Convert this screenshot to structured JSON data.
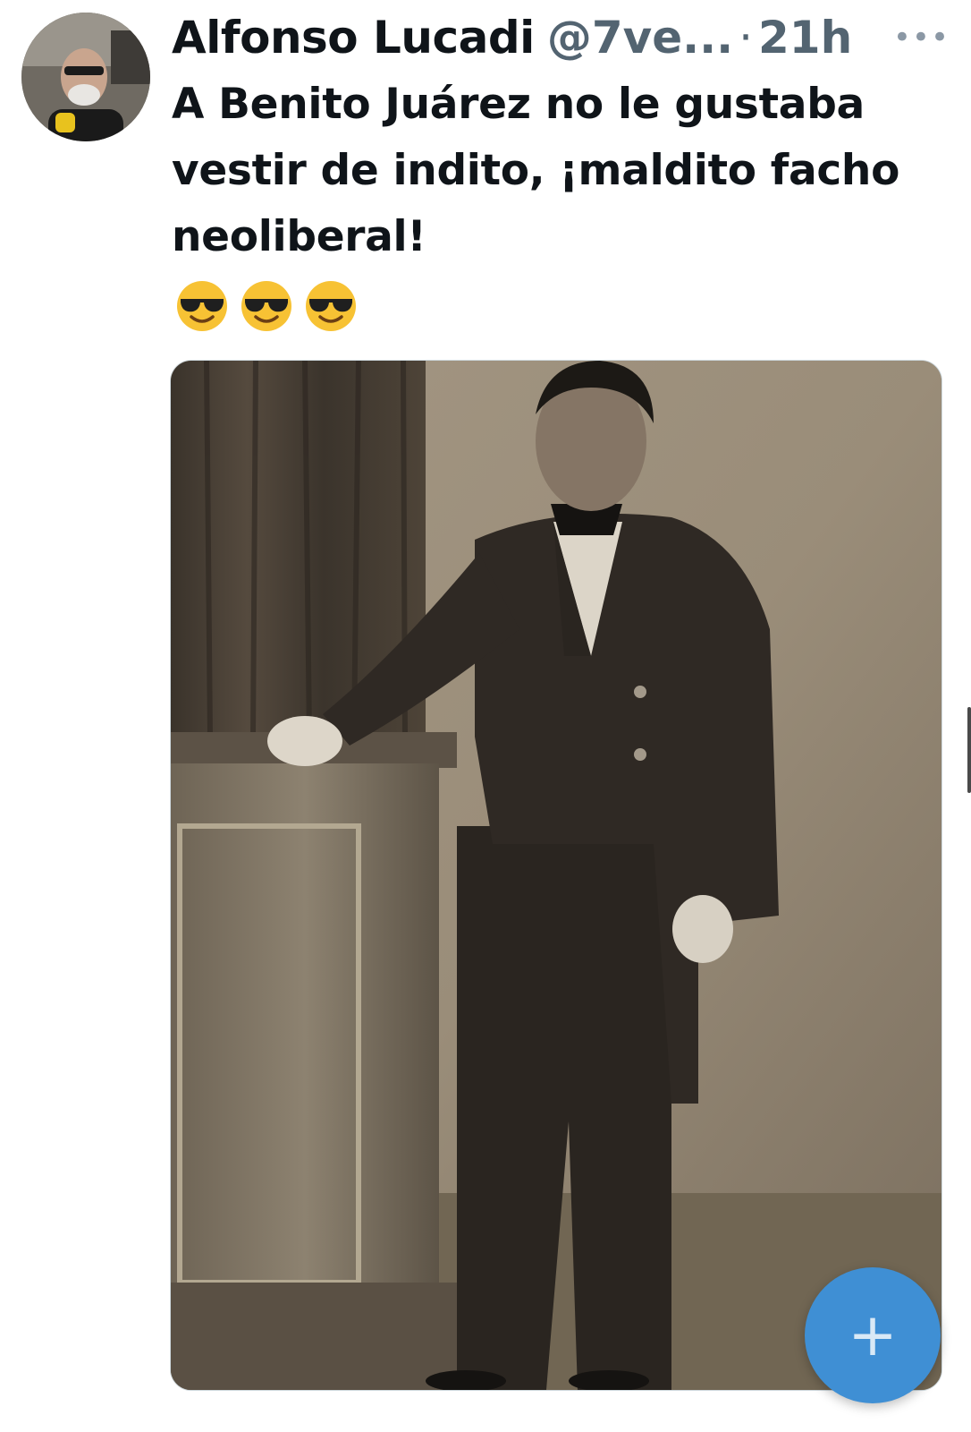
{
  "post": {
    "author_name": "Alfonso Lucadi",
    "author_handle": "@7ve...",
    "separator": "·",
    "time": "21h",
    "more_icon": "ellipsis-icon",
    "text": "A Benito Juárez no le gustaba vestir de indito, ¡maldito facho neoliberal!",
    "emojis": [
      "smiling-face-with-sunglasses",
      "smiling-face-with-sunglasses",
      "smiling-face-with-sunglasses"
    ]
  },
  "fab": {
    "icon": "plus-icon",
    "label": "+"
  },
  "colors": {
    "accent": "#3f8fd4",
    "text": "#0f1419",
    "muted": "#536471"
  }
}
